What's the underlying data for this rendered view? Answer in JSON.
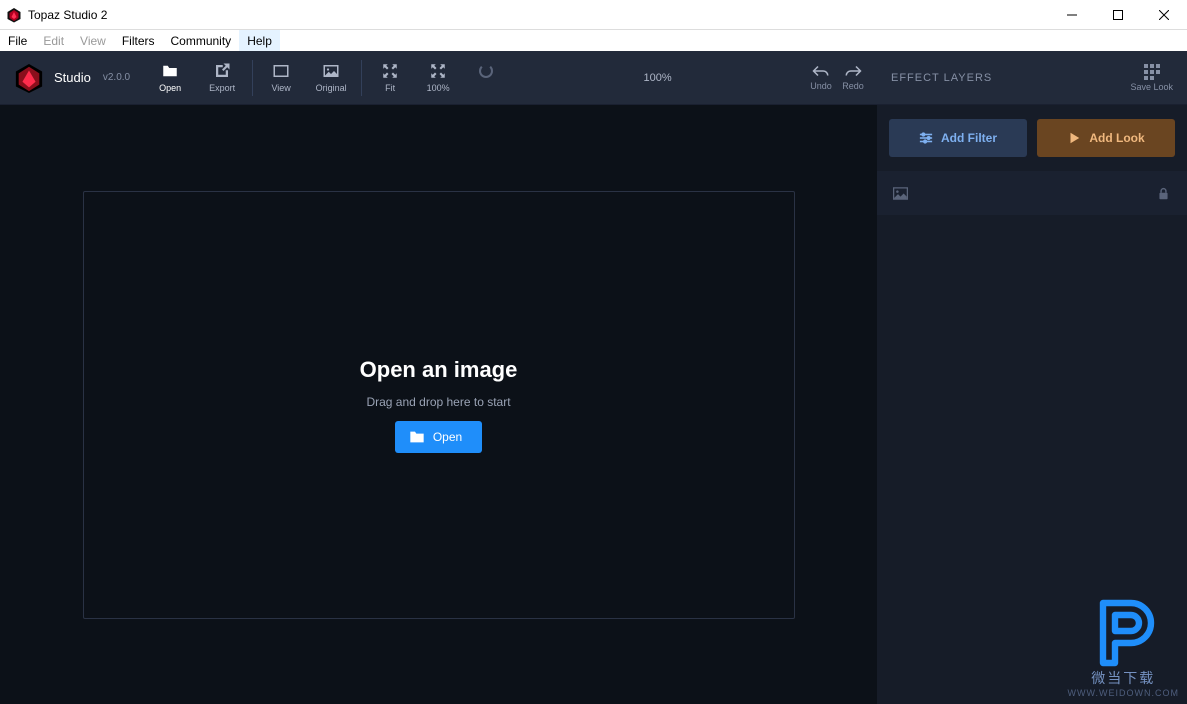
{
  "window": {
    "title": "Topaz Studio 2"
  },
  "menu": {
    "file": "File",
    "edit": "Edit",
    "view": "View",
    "filters": "Filters",
    "community": "Community",
    "help": "Help"
  },
  "brand": {
    "name": "Studio",
    "version": "v2.0.0"
  },
  "toolbar": {
    "open": "Open",
    "export": "Export",
    "view": "View",
    "original": "Original",
    "fit": "Fit",
    "hundred": "100%",
    "zoom_display": "100%",
    "undo": "Undo",
    "redo": "Redo"
  },
  "rightpanel": {
    "title": "EFFECT LAYERS",
    "savelook": "Save Look",
    "add_filter": "Add Filter",
    "add_look": "Add Look"
  },
  "dropzone": {
    "title": "Open an image",
    "subtitle": "Drag and drop here to start",
    "button": "Open"
  },
  "watermark": {
    "line1": "微当下载",
    "line2": "WWW.WEIDOWN.COM"
  }
}
